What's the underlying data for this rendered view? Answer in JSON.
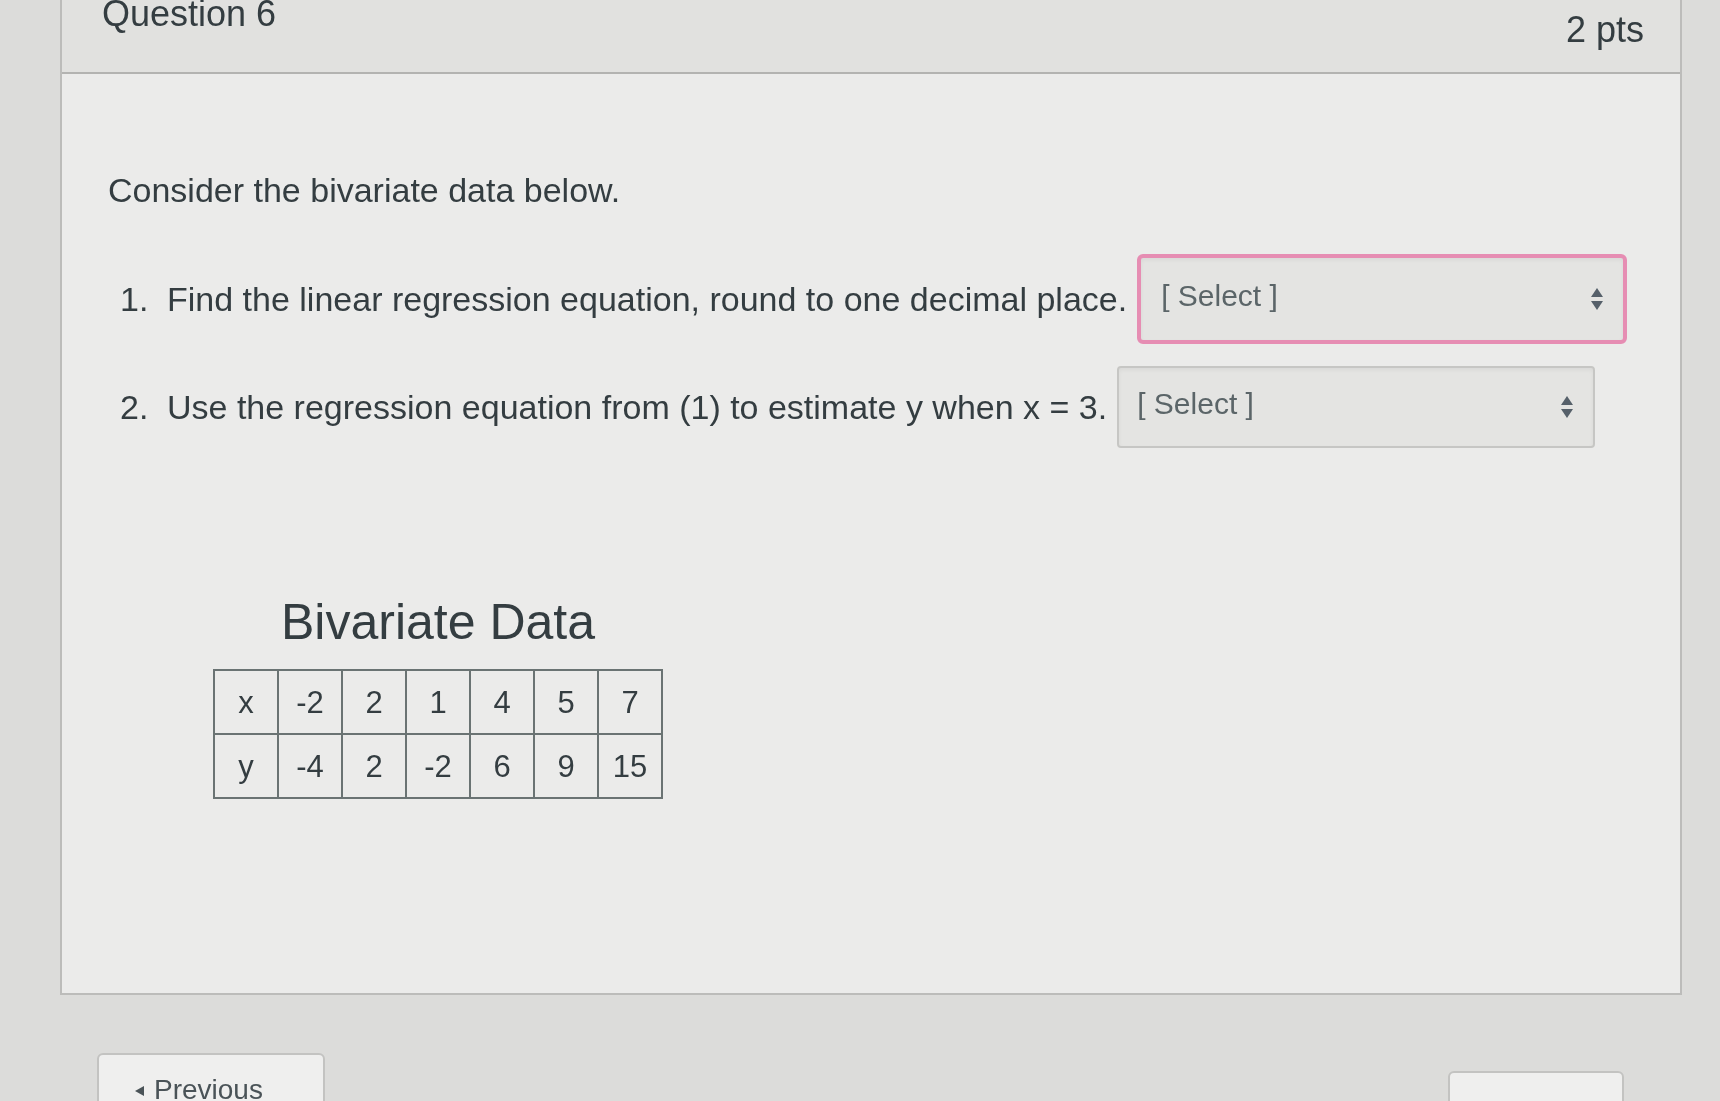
{
  "question": {
    "title": "Question 6",
    "points": "2 pts"
  },
  "intro": "Consider the bivariate data below.",
  "items": [
    {
      "number": "1.",
      "text": "Find the linear regression equation, round to one decimal place.",
      "dropdown": {
        "value": "[ Select ]",
        "focused": true
      }
    },
    {
      "number": "2.",
      "text": "Use the regression equation from (1) to estimate y when x = 3.",
      "dropdown": {
        "value": "[ Select ]",
        "focused": false
      }
    }
  ],
  "table": {
    "title": "Bivariate Data",
    "rows": [
      [
        "x",
        "-2",
        "2",
        "1",
        "4",
        "5",
        "7"
      ],
      [
        "y",
        "-4",
        "2",
        "-2",
        "6",
        "9",
        "15"
      ]
    ]
  },
  "navigation": {
    "previous": "Previous"
  }
}
